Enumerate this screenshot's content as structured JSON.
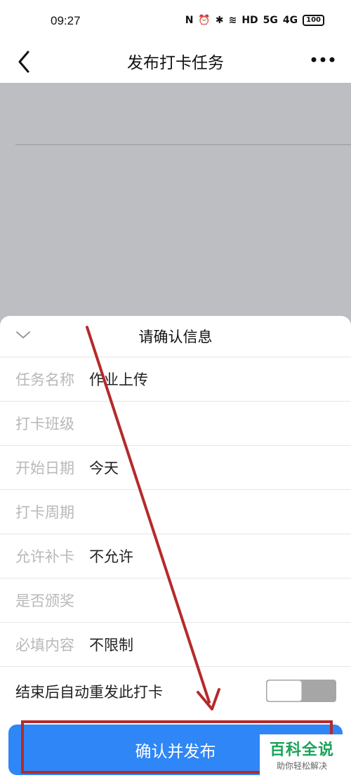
{
  "status_bar": {
    "time": "09:27",
    "icons": [
      "nfc-icon",
      "alarm-icon",
      "bluetooth-icon",
      "wifi-icon",
      "hd-icon",
      "signal-5g-icon",
      "signal-4g-icon"
    ],
    "hd_label": "HD",
    "signal1_label": "5G",
    "signal2_label": "4G",
    "battery": "100"
  },
  "nav": {
    "title": "发布打卡任务"
  },
  "sheet": {
    "title": "请确认信息",
    "rows": [
      {
        "label": "任务名称",
        "value": "作业上传"
      },
      {
        "label": "打卡班级",
        "value": ""
      },
      {
        "label": "开始日期",
        "value": "今天"
      },
      {
        "label": "打卡周期",
        "value": ""
      },
      {
        "label": "允许补卡",
        "value": "不允许"
      },
      {
        "label": "是否颁奖",
        "value": ""
      },
      {
        "label": "必填内容",
        "value": "不限制"
      }
    ],
    "auto_repost": {
      "label": "结束后自动重发此打卡",
      "enabled": false
    }
  },
  "publish_button": {
    "label": "确认并发布"
  },
  "watermark": {
    "main": "百科全说",
    "sub": "助你轻松解决"
  },
  "colors": {
    "primary": "#2f86f6",
    "highlight": "#b52a2a",
    "overlay": "#bdbec1",
    "watermark": "#1aa35a"
  }
}
